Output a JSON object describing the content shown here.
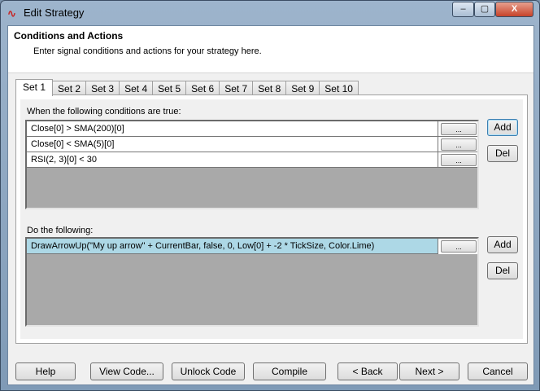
{
  "window": {
    "title": "Edit Strategy",
    "minimize": "–",
    "maximize": "▢",
    "close": "X"
  },
  "header": {
    "title": "Conditions and Actions",
    "subtitle": "Enter signal conditions and actions for your strategy here."
  },
  "tabs": [
    "Set 1",
    "Set 2",
    "Set 3",
    "Set 4",
    "Set 5",
    "Set 6",
    "Set 7",
    "Set 8",
    "Set 9",
    "Set 10"
  ],
  "conditions": {
    "label": "When the following conditions are true:",
    "rows": [
      "Close[0] > SMA(200)[0]",
      "Close[0] < SMA(5)[0]",
      "RSI(2, 3)[0] < 30"
    ],
    "add": "Add",
    "del": "Del"
  },
  "actions": {
    "label": "Do the following:",
    "rows": [
      "DrawArrowUp(\"My up arrow\" + CurrentBar, false, 0, Low[0] + -2 * TickSize, Color.Lime)"
    ],
    "add": "Add",
    "del": "Del"
  },
  "ellipsis": "...",
  "footer": {
    "help": "Help",
    "view_code": "View Code...",
    "unlock_code": "Unlock Code",
    "compile": "Compile",
    "back": "< Back",
    "next": "Next >",
    "cancel": "Cancel"
  }
}
